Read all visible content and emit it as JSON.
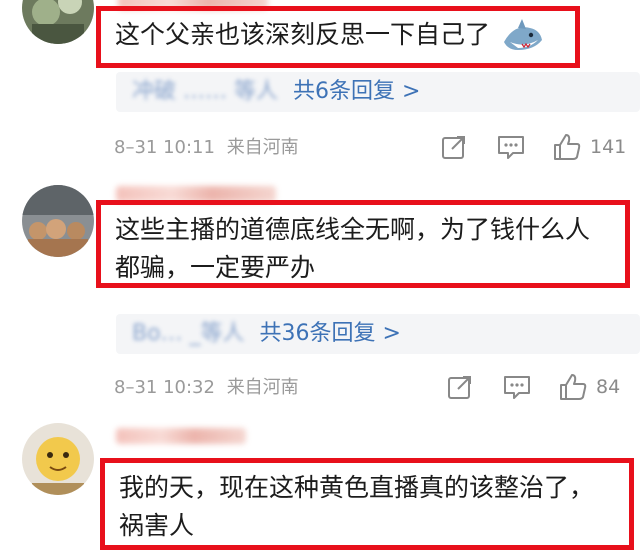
{
  "comments": [
    {
      "text": "这个父亲也该深刻反思一下自己了",
      "replies": {
        "names": "冲破 ……  等人",
        "count_label": "共6条回复 >"
      },
      "time": "8–31 10:11",
      "location": "来自河南",
      "likes": "141"
    },
    {
      "text": "这些主播的道德底线全无啊，为了钱什么人都骗，一定要严办",
      "replies": {
        "names": "Bo…  _等人",
        "count_label": "共36条回复 >"
      },
      "time": "8–31 10:32",
      "location": "来自河南",
      "likes": "84"
    },
    {
      "text": "我的天，现在这种黄色直播真的该整治了，祸害人"
    }
  ],
  "icons": {
    "share": "share-icon",
    "comment": "comment-icon",
    "like": "thumbs-up-icon",
    "sticker": "shark-emoji-icon"
  },
  "colors": {
    "highlight_border": "#e8101b",
    "link_blue": "#3d72b6",
    "meta_gray": "#9a9a9a",
    "reply_bg": "#f4f5f7"
  }
}
